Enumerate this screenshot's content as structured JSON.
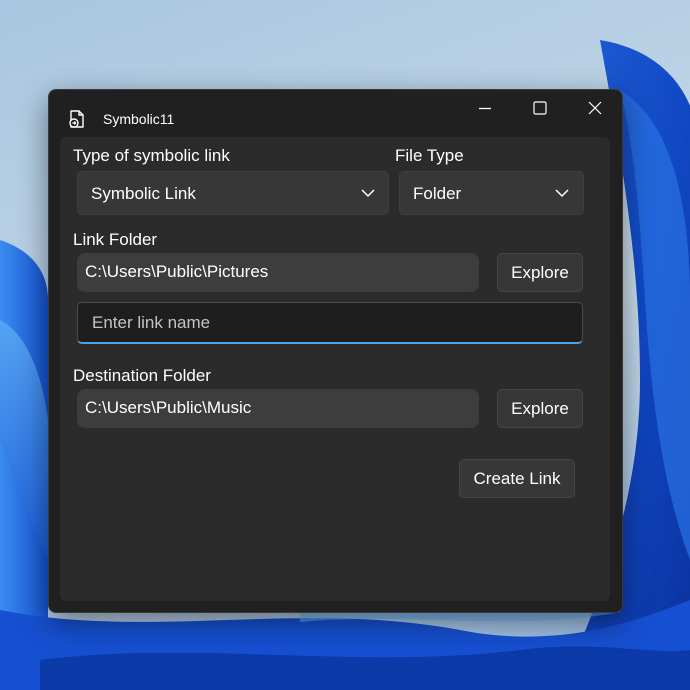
{
  "window": {
    "title": "Symbolic11",
    "icon": "document-link-icon"
  },
  "caption_buttons": [
    "minimize-icon",
    "maximize-icon",
    "close-icon"
  ],
  "form": {
    "link_type_label": "Type of symbolic link",
    "link_type_value": "Symbolic Link",
    "file_type_label": "File Type",
    "file_type_value": "Folder",
    "link_folder_label": "Link Folder",
    "link_folder_value": "C:\\Users\\Public\\Pictures",
    "explore_label_1": "Explore",
    "link_name_placeholder": "Enter link name",
    "link_name_value": "",
    "destination_folder_label": "Destination Folder",
    "destination_folder_value": "C:\\Users\\Public\\Music",
    "explore_label_2": "Explore",
    "create_link_label": "Create Link"
  },
  "colors": {
    "window_bg": "#202020",
    "panel_bg": "#2b2b2b",
    "control_bg": "#373737",
    "accent": "#4aa3e8",
    "text": "#ffffff"
  }
}
